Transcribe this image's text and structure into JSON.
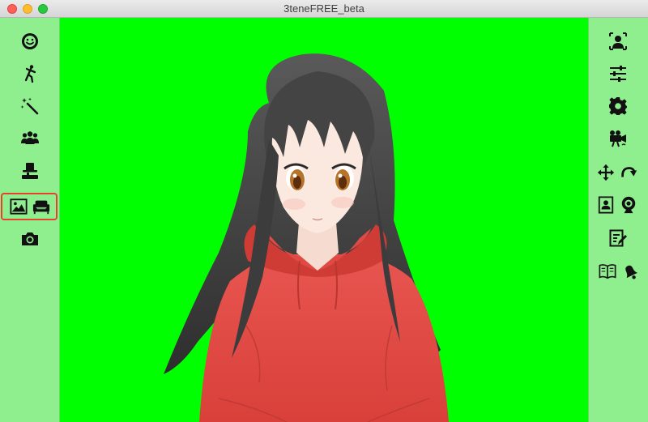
{
  "window": {
    "title": "3teneFREE_beta"
  },
  "left_toolbar": {
    "tools": [
      "face-smile-icon",
      "dancing-figure-icon",
      "magic-wand-icon",
      "people-group-icon",
      "hat-trick-icon",
      "image-background-icon",
      "sofa-icon",
      "camera-icon"
    ],
    "selected": "background-and-furniture"
  },
  "right_toolbar": {
    "tools": [
      "user-portrait-icon",
      "sliders-icon",
      "gear-icon",
      "video-camera-icon",
      "move-arrows-icon",
      "rotate-arrow-icon",
      "contact-card-icon",
      "webcam-icon",
      "edit-note-icon",
      "open-book-icon",
      "bell-icon"
    ]
  },
  "colors": {
    "stage_background": "#00ff00",
    "sidebar_background": "#8fef8f",
    "selection_outline": "#e8402a",
    "hair": "#3a3a3a",
    "hoodie": "#e04a44",
    "skin": "#fbe8df"
  }
}
